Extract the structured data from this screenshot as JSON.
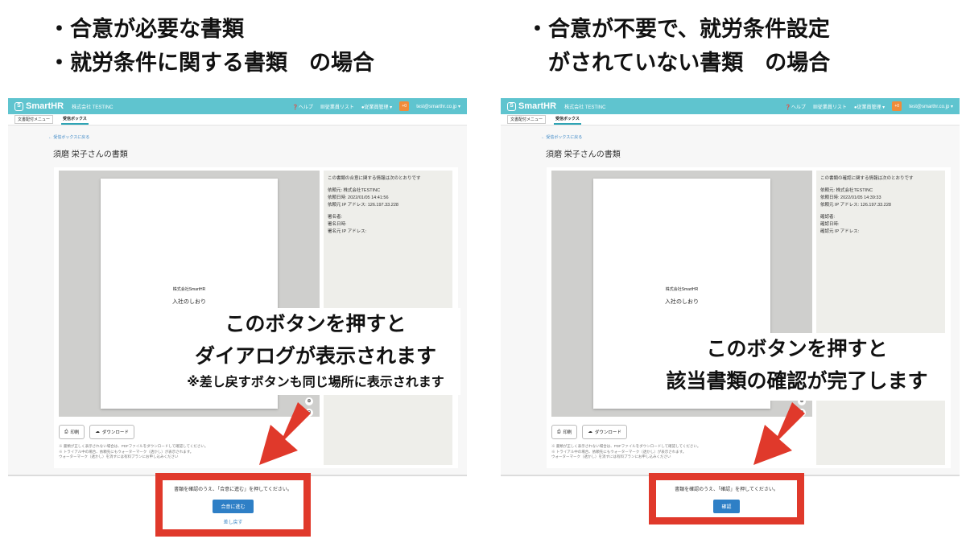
{
  "headings": {
    "left": [
      "・合意が必要な書類",
      "・就労条件に関する書類　の場合"
    ],
    "right": [
      "・合意が不要で、就労条件設定",
      "　がされていない書類　の場合"
    ]
  },
  "app": {
    "logo_text": "SmartHR",
    "company": "株式会社 TESTINC",
    "nav_help": "ヘルプ",
    "nav_employee_list": "従業員リスト",
    "nav_employee_mgmt": "従業員管理",
    "plus_badge": "+0",
    "user_email": "test@smarthr.co.jp",
    "tab_menu": "文書配付メニュー",
    "tab_inbox": "受信ボックス",
    "back_link": "受信ボックスに戻る",
    "page_title": "須磨 栄子さんの書類"
  },
  "document": {
    "company": "株式会社SmartHR",
    "title": "入社のしおり"
  },
  "left_info": {
    "intro": "この書類の合意に関する情報は次のとおりです",
    "requester": "依頼元: 株式会社TESTINC",
    "request_date": "依頼日時: 2022/01/05 14:41:56",
    "request_ip": "依頼元 IP アドレス: 126.197.33.228",
    "signer": "署名者:",
    "sign_date": "署名日時:",
    "sign_ip": "署名元 IP アドレス:"
  },
  "right_info": {
    "intro": "この書類の確認に関する情報は次のとおりです",
    "requester": "依頼元: 株式会社TESTINC",
    "request_date": "依頼日時: 2022/01/05 14:39:33",
    "request_ip": "依頼元 IP アドレス: 126.197.33.228",
    "confirmer": "確認者:",
    "confirm_date": "確認日時:",
    "confirm_ip": "確認元 IP アドレス:"
  },
  "buttons": {
    "print": "印刷",
    "download": "ダウンロード",
    "proceed": "合意に進む",
    "send_back": "差し戻す",
    "confirm": "確認"
  },
  "notes": [
    "※ 書類が正しく表示されない場合は、PDFファイルをダウンロードして確認してください。",
    "※ トライアル中の場合、依頼先にもウォーターマーク（透かし）が表示されます。",
    "ウォーターマーク（透かし）を消すには有料プランにお申し込みください"
  ],
  "left_action": {
    "instruction": "書類を確認のうえ、「合意に進む」を押してください。"
  },
  "right_action": {
    "instruction": "書類を確認のうえ、「確認」を押してください。"
  },
  "callouts": {
    "left_line1": "このボタンを押すと",
    "left_line2": "ダイアログが表示されます",
    "left_note": "※差し戻すボタンも同じ場所に表示されます",
    "right_line1": "このボタンを押すと",
    "right_line2": "該当書類の確認が完了します"
  },
  "colors": {
    "header": "#5fc4cf",
    "highlight": "#e0392b",
    "primary_button": "#2e7fc6"
  }
}
